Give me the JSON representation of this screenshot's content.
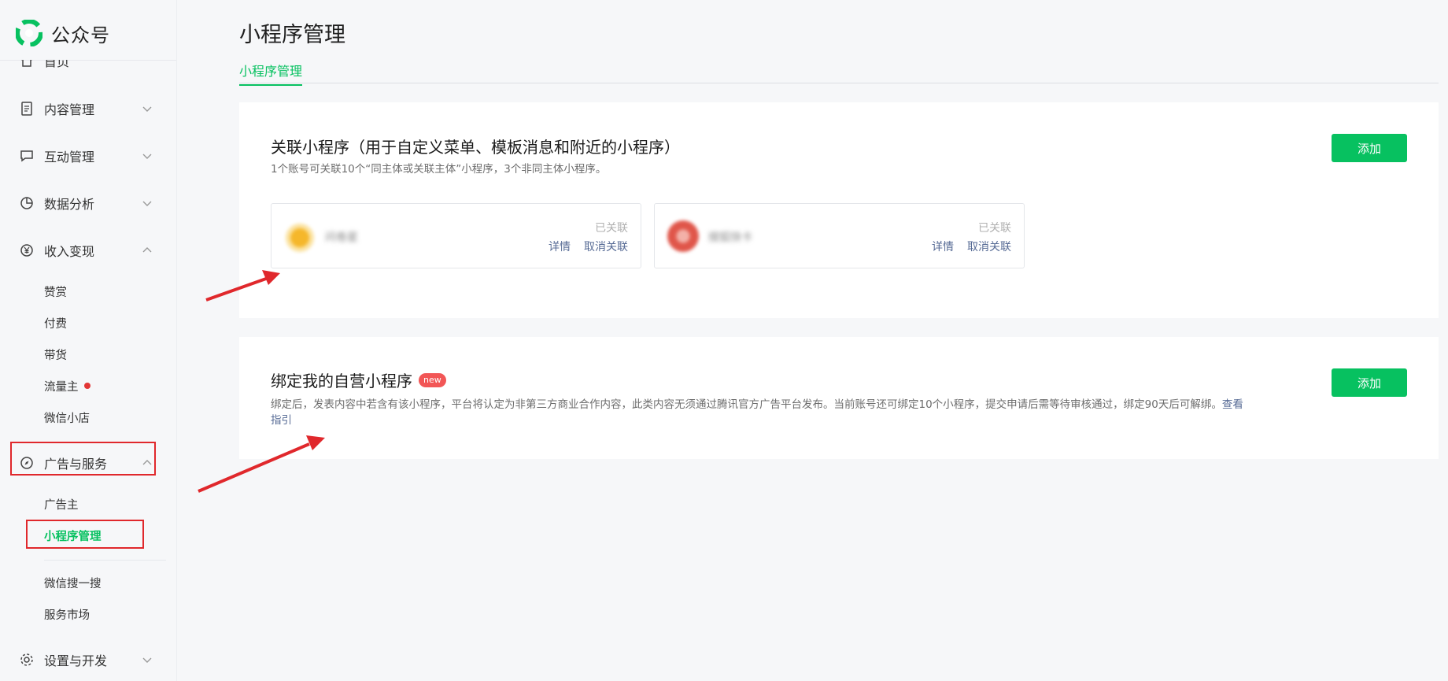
{
  "brand": {
    "name": "公众号"
  },
  "sidebar": {
    "items": [
      {
        "label": "首页",
        "icon": "home-icon"
      },
      {
        "label": "内容管理",
        "icon": "document-icon"
      },
      {
        "label": "互动管理",
        "icon": "chat-icon"
      },
      {
        "label": "数据分析",
        "icon": "pie-chart-icon"
      },
      {
        "label": "收入变现",
        "icon": "yen-icon"
      },
      {
        "label": "广告与服务",
        "icon": "compass-icon"
      },
      {
        "label": "设置与开发",
        "icon": "gear-icon"
      }
    ],
    "income_sub": [
      "赞赏",
      "付费",
      "带货",
      "流量主",
      "微信小店"
    ],
    "ads_sub": [
      "广告主",
      "小程序管理",
      "微信搜一搜",
      "服务市场"
    ]
  },
  "page": {
    "title": "小程序管理",
    "tab": "小程序管理"
  },
  "linked_card": {
    "title": "关联小程序（用于自定义菜单、模板消息和附近的小程序）",
    "desc": "1个账号可关联10个“同主体或关联主体”小程序，3个非同主体小程序。",
    "add_label": "添加",
    "items": [
      {
        "name": "问卷星",
        "status": "已关联",
        "detail": "详情",
        "unlink": "取消关联"
      },
      {
        "name": "搜狐快卡",
        "status": "已关联",
        "detail": "详情",
        "unlink": "取消关联"
      }
    ]
  },
  "bind_card": {
    "title": "绑定我的自营小程序",
    "badge": "new",
    "desc": "绑定后，发表内容中若含有该小程序，平台将认定为非第三方商业合作内容，此类内容无须通过腾讯官方广告平台发布。当前账号还可绑定10个小程序，提交申请后需等待审核通过，绑定90天后可解绑。",
    "link_a": "查看",
    "link_b": "指引",
    "add_label": "添加"
  },
  "colors": {
    "accent": "#07c160",
    "link": "#576b95",
    "annotation": "#e0282c",
    "badge": "#f25656"
  }
}
